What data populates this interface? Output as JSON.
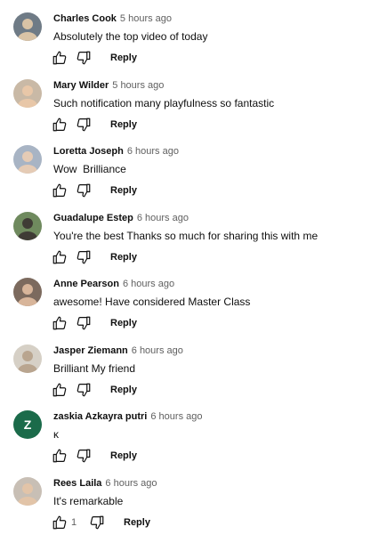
{
  "comments": [
    {
      "author": "Charles Cook",
      "time": "5 hours ago",
      "text": "Absolutely the top video of today",
      "reply_label": "Reply",
      "avatar": {
        "type": "photo",
        "bg": "#6f7b86",
        "fg": "#d9c3a6"
      }
    },
    {
      "author": "Mary Wilder",
      "time": "5 hours ago",
      "text": "Such notification many playfulness so fantastic",
      "reply_label": "Reply",
      "avatar": {
        "type": "photo",
        "bg": "#c9b9a6",
        "fg": "#e8c7a8"
      }
    },
    {
      "author": "Loretta Joseph",
      "time": "6 hours ago",
      "text": "Wow  Brilliance",
      "reply_label": "Reply",
      "avatar": {
        "type": "photo",
        "bg": "#a8b4c4",
        "fg": "#e5cbb5"
      }
    },
    {
      "author": "Guadalupe Estep",
      "time": "6 hours ago",
      "text": "You're the best Thanks so much for sharing this with me",
      "reply_label": "Reply",
      "avatar": {
        "type": "photo",
        "bg": "#6f8a5e",
        "fg": "#3f3b35"
      }
    },
    {
      "author": "Anne Pearson",
      "time": "6 hours ago",
      "text": "awesome! Have considered Master Class",
      "reply_label": "Reply",
      "avatar": {
        "type": "photo",
        "bg": "#7c6a5e",
        "fg": "#d8b59a"
      }
    },
    {
      "author": "Jasper Ziemann",
      "time": "6 hours ago",
      "text": "Brilliant My friend",
      "reply_label": "Reply",
      "avatar": {
        "type": "photo",
        "bg": "#d6d0c6",
        "fg": "#b9a58f"
      }
    },
    {
      "author": "zaskia Azkayra putri",
      "time": "6 hours ago",
      "text": "κ",
      "reply_label": "Reply",
      "avatar": {
        "type": "letter",
        "letter": "Z",
        "bg": "#1b6b4a"
      }
    },
    {
      "author": "Rees Laila",
      "time": "6 hours ago",
      "text": "It's remarkable",
      "reply_label": "Reply",
      "like_count": "1",
      "avatar": {
        "type": "photo",
        "bg": "#c8bfb5",
        "fg": "#e2c4a8"
      }
    }
  ]
}
